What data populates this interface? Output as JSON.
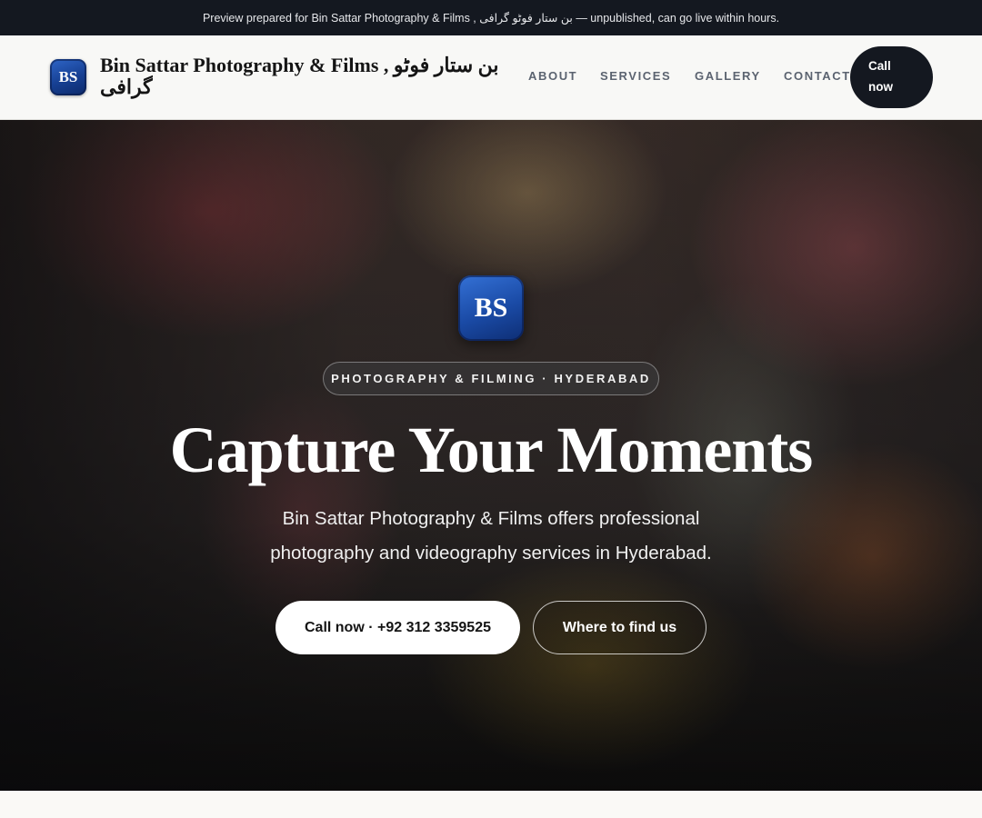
{
  "banner": {
    "text": "Preview prepared for Bin Sattar Photography & Films , بن ستار فوٹو گرافی — unpublished, can go live within hours."
  },
  "header": {
    "logo_initials": "BS",
    "brand_name": "Bin Sattar Photography & Films , بن ستار فوٹو گرافی",
    "nav": {
      "about": "ABOUT",
      "services": "SERVICES",
      "gallery": "GALLERY",
      "contact": "CONTACT"
    },
    "call_label": "Call now"
  },
  "hero": {
    "logo_initials": "BS",
    "tagline": "PHOTOGRAPHY & FILMING · HYDERABAD",
    "title": "Capture Your Moments",
    "subtitle": "Bin Sattar Photography & Films offers professional photography and videography services in Hyderabad.",
    "primary_button": "Call now · +92 312 3359525",
    "secondary_button": "Where to find us"
  },
  "colors": {
    "dark": "#141820",
    "logo_blue": "#1a4aa5",
    "page_bg": "#faf9f6"
  }
}
